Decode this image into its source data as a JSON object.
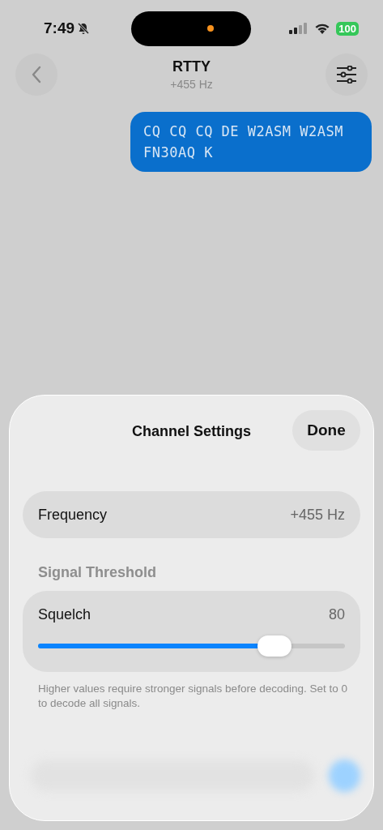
{
  "status_bar": {
    "time": "7:49",
    "silent": true,
    "battery": "100"
  },
  "nav": {
    "title": "RTTY",
    "subtitle": "+455 Hz"
  },
  "messages": [
    {
      "text": "CQ CQ CQ DE W2ASM W2ASM FN30AQ K"
    }
  ],
  "sheet": {
    "title": "Channel Settings",
    "done": "Done",
    "frequency": {
      "label": "Frequency",
      "value": "+455 Hz"
    },
    "section": "Signal Threshold",
    "squelch": {
      "label": "Squelch",
      "value": "80",
      "level": 0.77
    },
    "footnote": "Higher values require stronger signals before decoding. Set to 0 to decode all signals."
  }
}
